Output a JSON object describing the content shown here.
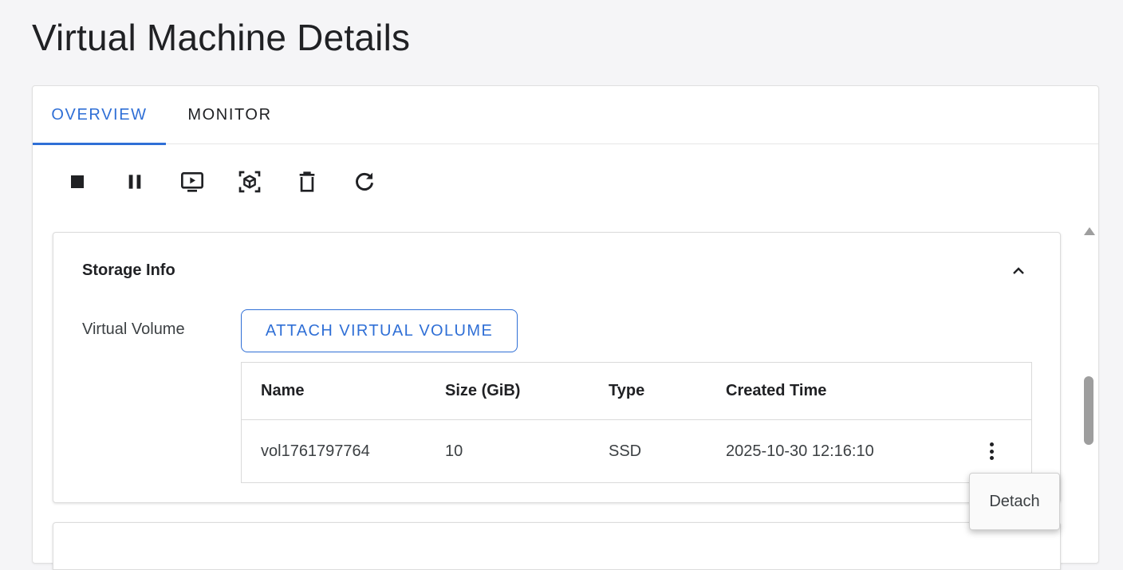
{
  "page": {
    "title": "Virtual Machine Details"
  },
  "tabs": [
    {
      "label": "OVERVIEW",
      "active": true
    },
    {
      "label": "MONITOR",
      "active": false
    }
  ],
  "toolbar": {
    "icons": [
      "stop-icon",
      "pause-icon",
      "console-icon",
      "snapshot-icon",
      "delete-icon",
      "refresh-icon"
    ]
  },
  "storage": {
    "title": "Storage Info",
    "virtual_volume_label": "Virtual Volume",
    "attach_button_label": "ATTACH VIRTUAL VOLUME",
    "table": {
      "columns": [
        "Name",
        "Size (GiB)",
        "Type",
        "Created Time"
      ],
      "rows": [
        {
          "name": "vol1761797764",
          "size": "10",
          "type": "SSD",
          "created": "2025-10-30 12:16:10"
        }
      ]
    }
  },
  "row_menu": {
    "items": [
      "Detach"
    ]
  },
  "colors": {
    "accent": "#2f6fd6",
    "background": "#f5f5f7",
    "text": "#202124"
  }
}
